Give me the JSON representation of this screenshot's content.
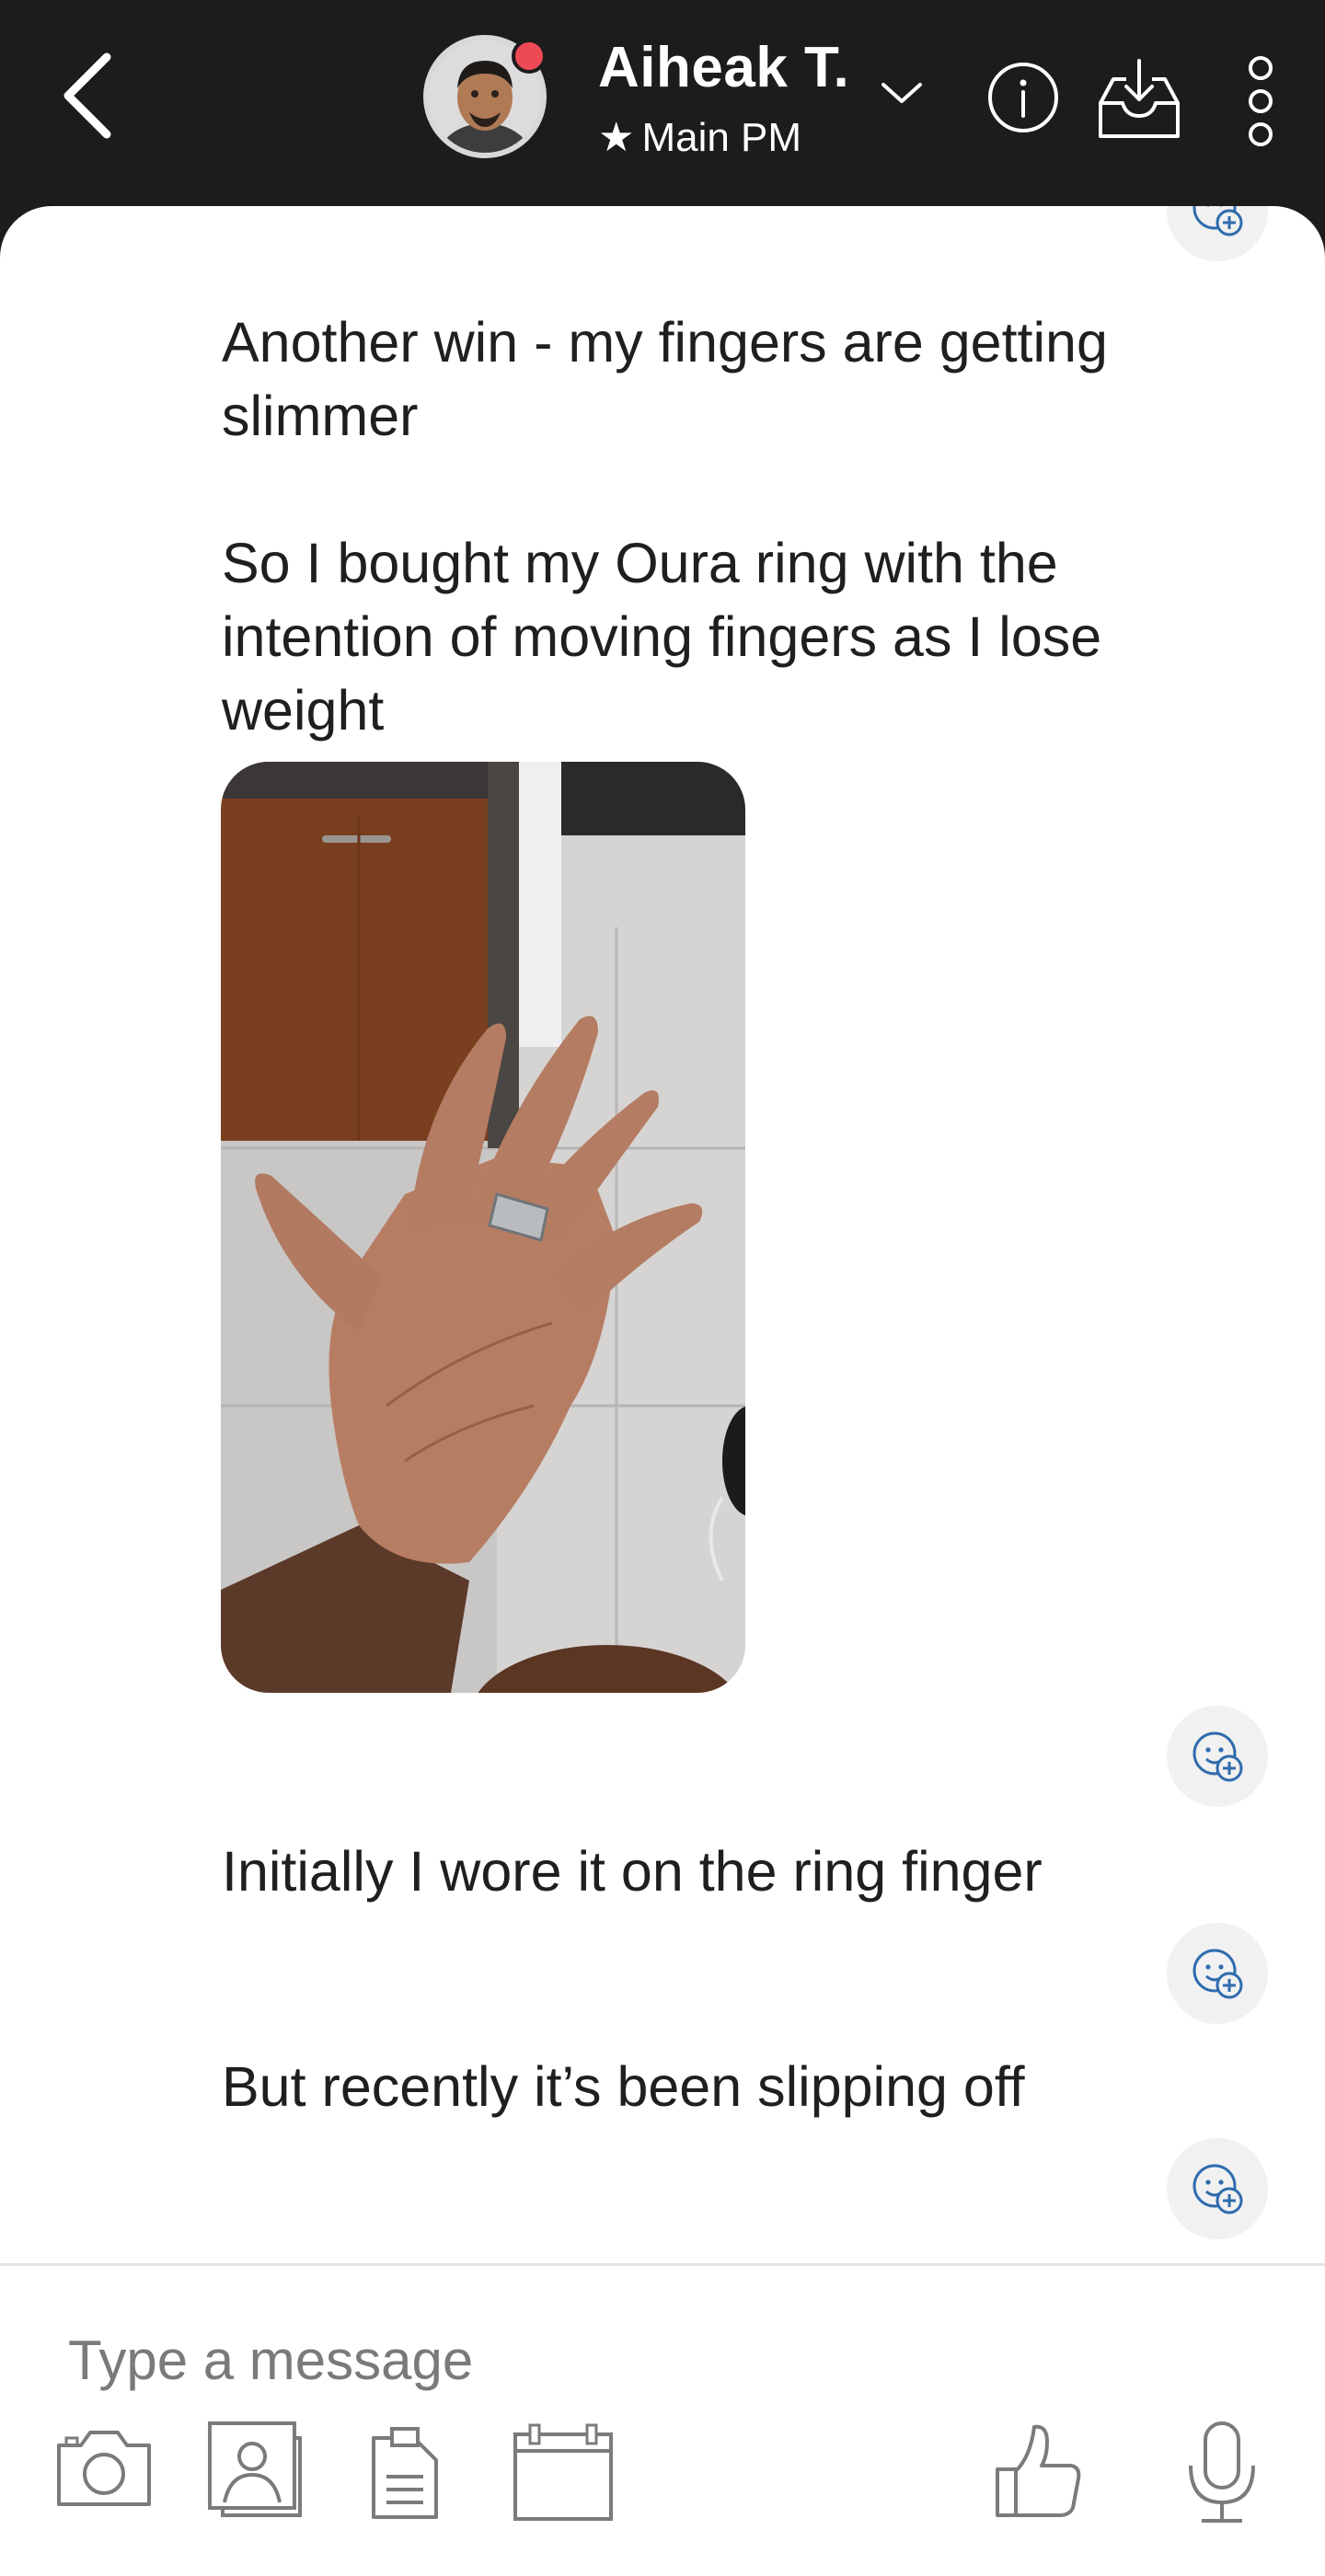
{
  "header": {
    "contact_name": "Aiheak T.",
    "contact_subtitle": "Main PM",
    "status_color": "#ee4a55",
    "icons": [
      "back-icon",
      "chevron-down-icon",
      "info-icon",
      "inbox-download-icon",
      "more-vertical-icon"
    ]
  },
  "messages": [
    {
      "text": "Another win - my fingers are getting\nslimmer"
    },
    {
      "text": "So I bought my Oura ring with the\nintention of moving fingers as I lose\nweight"
    },
    {
      "type": "image",
      "description_icon": "photo-hand-with-ring"
    },
    {
      "text": "Initially I wore it on the ring finger"
    },
    {
      "text": "But recently it’s been slipping off"
    }
  ],
  "composer": {
    "placeholder": "Type a message",
    "tools": [
      "camera-icon",
      "gallery-icon",
      "document-icon",
      "calendar-icon",
      "thumbs-up-icon",
      "microphone-icon"
    ]
  }
}
